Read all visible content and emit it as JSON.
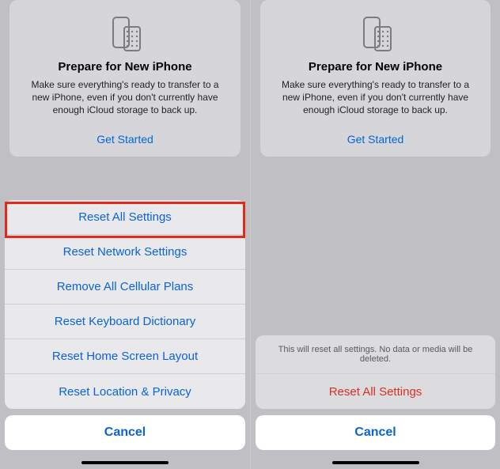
{
  "card": {
    "title": "Prepare for New iPhone",
    "desc": "Make sure everything's ready to transfer to a new iPhone, even if you don't currently have enough iCloud storage to back up.",
    "cta": "Get Started"
  },
  "sheet_left": {
    "items": [
      "Reset All Settings",
      "Reset Network Settings",
      "Remove All Cellular Plans",
      "Reset Keyboard Dictionary",
      "Reset Home Screen Layout",
      "Reset Location & Privacy"
    ],
    "cancel": "Cancel"
  },
  "confirm": {
    "message": "This will reset all settings. No data or media will be deleted.",
    "action": "Reset All Settings",
    "cancel": "Cancel"
  }
}
